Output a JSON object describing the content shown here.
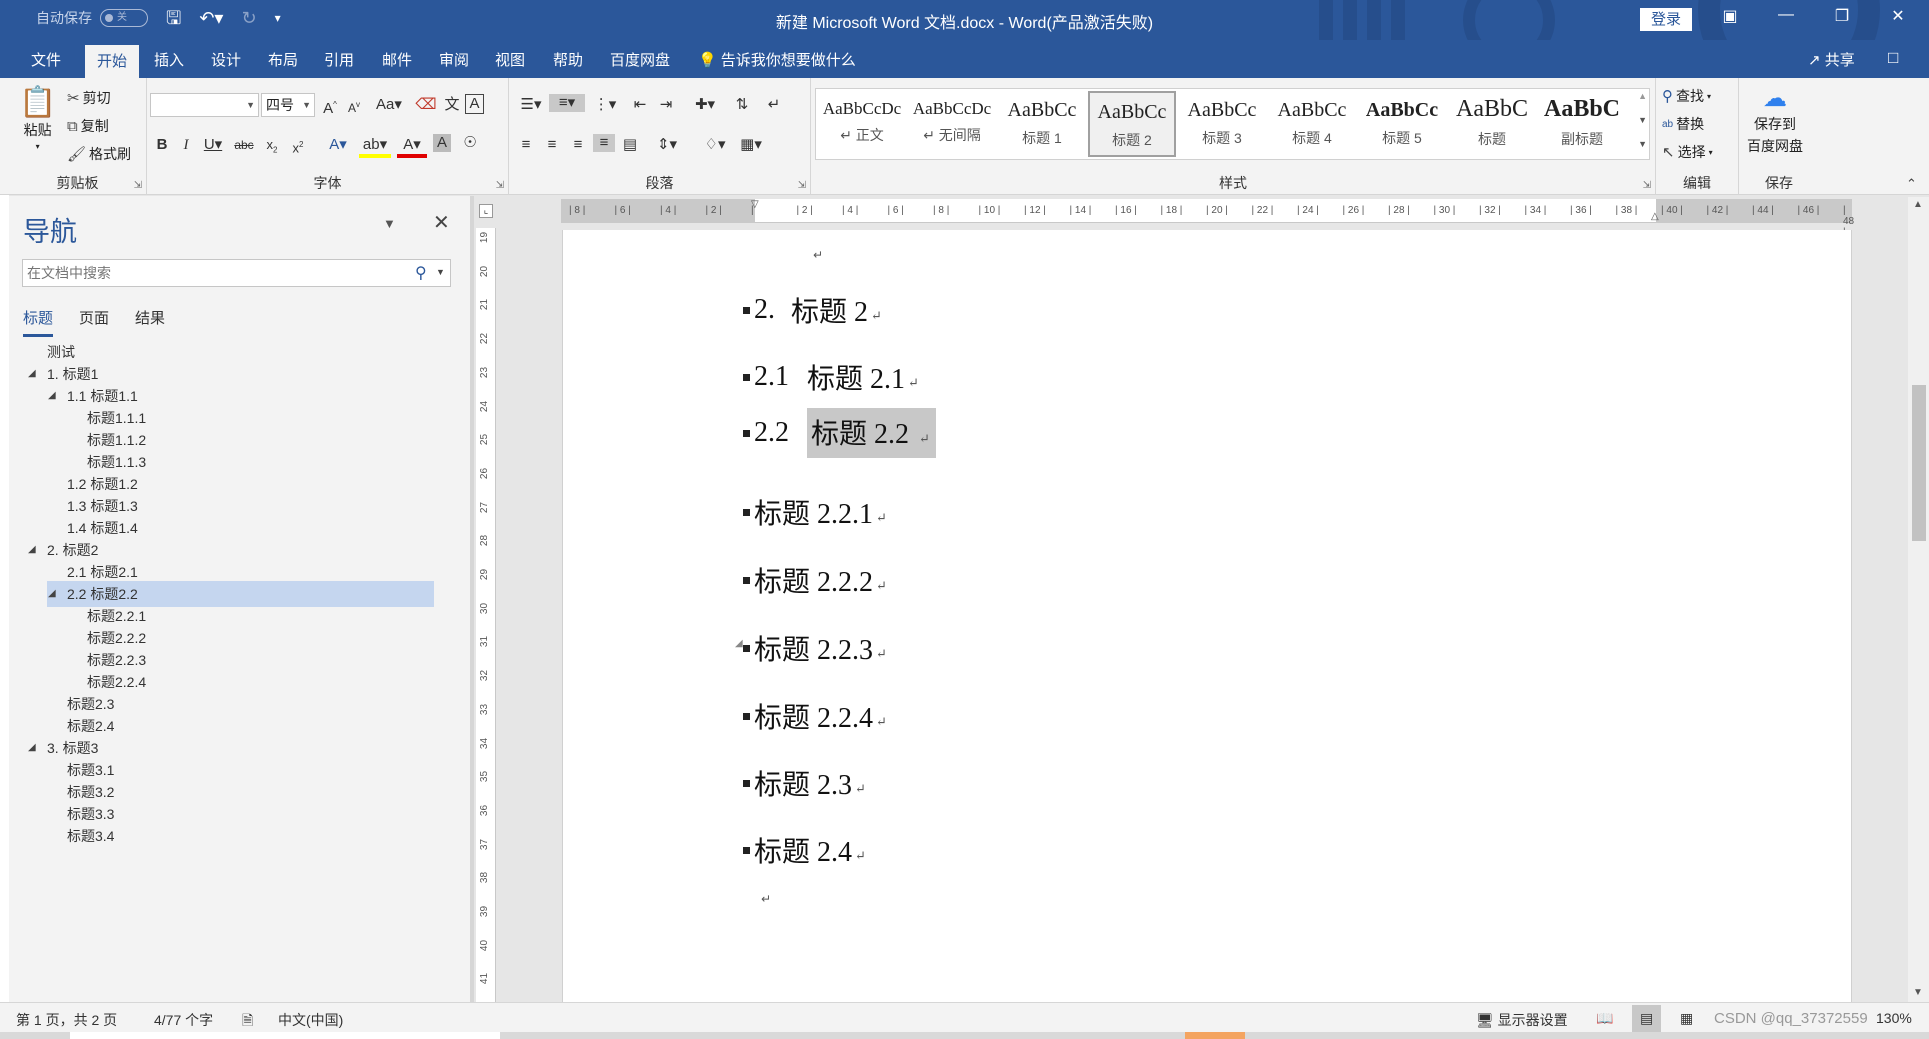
{
  "titlebar": {
    "autosave_label": "自动保存",
    "autosave_state": "关",
    "title": "新建 Microsoft Word 文档.docx  -  Word(产品激活失败)",
    "login_label": "登录"
  },
  "tabs": [
    "文件",
    "开始",
    "插入",
    "设计",
    "布局",
    "引用",
    "邮件",
    "审阅",
    "视图",
    "帮助",
    "百度网盘"
  ],
  "tell_me": "告诉我你想要做什么",
  "share_label": "共享",
  "clipboard": {
    "paste": "粘贴",
    "cut": "剪切",
    "copy": "复制",
    "format_painter": "格式刷",
    "label": "剪贴板"
  },
  "font": {
    "name_value": "",
    "size_value": "四号",
    "label": "字体"
  },
  "paragraph": {
    "label": "段落"
  },
  "styles": {
    "label": "样式",
    "items": [
      {
        "preview": "AaBbCcDc",
        "name": "↵ 正文"
      },
      {
        "preview": "AaBbCcDc",
        "name": "↵ 无间隔"
      },
      {
        "preview": "AaBbCc",
        "name": "标题 1"
      },
      {
        "preview": "AaBbCc",
        "name": "标题 2"
      },
      {
        "preview": "AaBbCc",
        "name": "标题 3"
      },
      {
        "preview": "AaBbCc",
        "name": "标题 4"
      },
      {
        "preview": "AaBbCc",
        "name": "标题 5"
      },
      {
        "preview": "AaBbC",
        "name": "标题"
      },
      {
        "preview": "AaBbC",
        "name": "副标题"
      }
    ]
  },
  "editing": {
    "find": "查找",
    "replace": "替换",
    "select": "选择",
    "label": "编辑"
  },
  "save_group": {
    "save_to": "保存到",
    "baidu": "百度网盘",
    "label": "保存"
  },
  "nav": {
    "title": "导航",
    "search_placeholder": "在文档中搜索",
    "tabs": [
      "标题",
      "页面",
      "结果"
    ],
    "tree": [
      {
        "label": "测试"
      },
      {
        "label": "1. 标题1"
      },
      {
        "label": "1.1 标题1.1"
      },
      {
        "label": "标题1.1.1"
      },
      {
        "label": "标题1.1.2"
      },
      {
        "label": "标题1.1.3"
      },
      {
        "label": "1.2 标题1.2"
      },
      {
        "label": "1.3 标题1.3"
      },
      {
        "label": "1.4 标题1.4"
      },
      {
        "label": "2. 标题2"
      },
      {
        "label": "2.1 标题2.1"
      },
      {
        "label": "2.2 标题2.2"
      },
      {
        "label": "标题2.2.1"
      },
      {
        "label": "标题2.2.2"
      },
      {
        "label": "标题2.2.3"
      },
      {
        "label": "标题2.2.4"
      },
      {
        "label": "标题2.3"
      },
      {
        "label": "标题2.4"
      },
      {
        "label": "3. 标题3"
      },
      {
        "label": "标题3.1"
      },
      {
        "label": "标题3.2"
      },
      {
        "label": "标题3.3"
      },
      {
        "label": "标题3.4"
      }
    ]
  },
  "ruler": {
    "h_ticks": [
      "8",
      "6",
      "4",
      "2",
      "",
      "2",
      "4",
      "6",
      "8",
      "10",
      "12",
      "14",
      "16",
      "18",
      "20",
      "22",
      "24",
      "26",
      "28",
      "30",
      "32",
      "34",
      "36",
      "38",
      "40",
      "42",
      "44",
      "46",
      "48"
    ],
    "v_ticks": [
      "19",
      "20",
      "21",
      "22",
      "23",
      "24",
      "25",
      "26",
      "27",
      "28",
      "29",
      "30",
      "31",
      "32",
      "33",
      "34",
      "35",
      "36",
      "37",
      "38",
      "39",
      "40",
      "41"
    ]
  },
  "document": {
    "paragraphs": [
      {
        "num": "2.",
        "text": "标题 2"
      },
      {
        "num": "2.1",
        "text": "标题 2.1"
      },
      {
        "num": "2.2",
        "text": "标题 2.2"
      },
      {
        "num": "",
        "text": "标题 2.2.1"
      },
      {
        "num": "",
        "text": "标题 2.2.2"
      },
      {
        "num": "",
        "text": "标题 2.2.3"
      },
      {
        "num": "",
        "text": "标题 2.2.4"
      },
      {
        "num": "",
        "text": "标题 2.3"
      },
      {
        "num": "",
        "text": "标题 2.4"
      }
    ],
    "para_mark": "↵"
  },
  "status": {
    "page": "第 1 页，共 2 页",
    "words": "4/77 个字",
    "language": "中文(中国)",
    "display_settings": "显示器设置",
    "zoom": "130%",
    "watermark": "CSDN @qq_37372559"
  },
  "colors": {
    "accent": "#2b579a",
    "selection": "#c5d6ef",
    "highlight": "#c8c8c8"
  }
}
